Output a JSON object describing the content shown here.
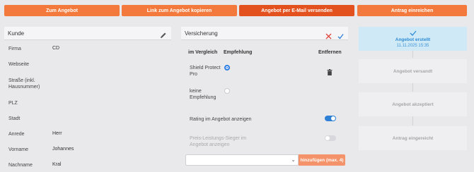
{
  "toolbar": {
    "to_offer": "Zum Angebot",
    "copy_link": "Link zum Angebot kopieren",
    "send_email": "Angebot per E-Mail versenden",
    "submit_application": "Antrag einreichen"
  },
  "customer": {
    "title": "Kunde",
    "fields": [
      {
        "label": "Firma",
        "value": "CD"
      },
      {
        "label": "Webseite",
        "value": ""
      },
      {
        "label": "Straße (inkl. Hausnummer)",
        "value": ""
      },
      {
        "label": "PLZ",
        "value": ""
      },
      {
        "label": "Stadt",
        "value": ""
      },
      {
        "label": "Anrede",
        "value": "Herr"
      },
      {
        "label": "Vorname",
        "value": "Johannes"
      },
      {
        "label": "Nachname",
        "value": "Kral"
      }
    ]
  },
  "insurance": {
    "title": "Versicherung",
    "columns": {
      "compare": "im Vergleich",
      "recommend": "Empfehlung",
      "remove": "Entfernen"
    },
    "rows": [
      {
        "name": "Shield Protect Pro",
        "recommended": true
      },
      {
        "name": "keine Empfehlung",
        "recommended": false
      }
    ],
    "rating_label": "Rating im Angebot anzeigen",
    "rating_on": true,
    "price_winner_label": "Preis-Leistungs-Sieger im Angebot anzeigen",
    "price_winner_on": false,
    "select_value": "",
    "add_button": "hinzufügen (max. 4)"
  },
  "status": {
    "steps": [
      {
        "label": "Angebot erstellt",
        "date": "11.11.2025 15:35",
        "active": true
      },
      {
        "label": "Angebot versandt",
        "active": false
      },
      {
        "label": "Angebot akzeptiert",
        "active": false
      },
      {
        "label": "Antrag eingereicht",
        "active": false
      }
    ],
    "active_color": "#2f8cd4"
  },
  "colors": {
    "orange": "#f37a3c",
    "orange_dark": "#e3521e",
    "blue": "#2e7fd6"
  }
}
